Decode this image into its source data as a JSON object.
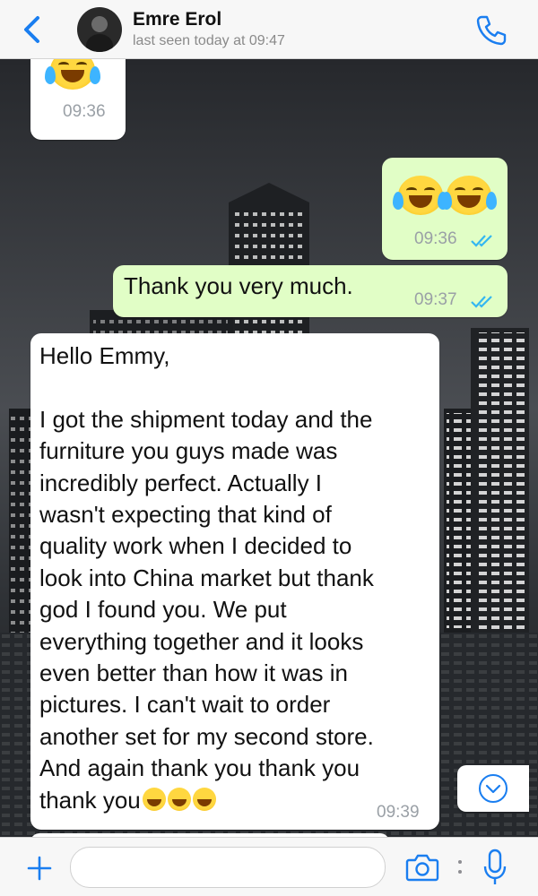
{
  "header": {
    "back_icon": "chevron-left-icon",
    "contact_name": "Emre Erol",
    "last_seen": "last seen today at 09:47",
    "call_icon": "phone-icon",
    "accent_color": "#1a7ef0"
  },
  "messages": [
    {
      "direction": "incoming",
      "content": "face-with-tears-of-joy-emoji",
      "time": "09:36"
    },
    {
      "direction": "outgoing",
      "content": "face-with-tears-of-joy-emoji ×2",
      "time": "09:36",
      "status": "read"
    },
    {
      "direction": "outgoing",
      "text": "Thank you very much.",
      "time": "09:37",
      "status": "read"
    },
    {
      "direction": "incoming",
      "greeting": "Hello Emmy,",
      "lines": [
        "I got the shipment today and the",
        "furniture you guys made was",
        "incredibly perfect. Actually I",
        "wasn't expecting that kind of",
        "quality work when I decided to",
        "look into China market but thank",
        "god I found you. We put",
        "everything together and it looks",
        "even better than how it was in",
        "pictures. I can't wait to order",
        "another set for my second store.",
        "And again thank you thank you",
        "thank you"
      ],
      "trailing_emoji": "grinning-face-emoji ×3",
      "time": "09:39"
    }
  ],
  "scroll_down_icon": "chevron-down-circle-icon",
  "input_bar": {
    "plus_icon": "plus-icon",
    "message_placeholder": "",
    "camera_icon": "camera-icon",
    "mic_icon": "microphone-icon"
  },
  "colors": {
    "incoming_bubble": "#ffffff",
    "outgoing_bubble": "#e1fec6",
    "read_ticks": "#34b7f1"
  }
}
